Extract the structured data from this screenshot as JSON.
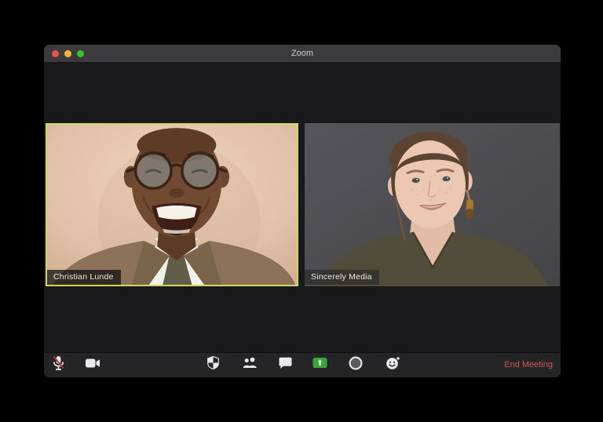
{
  "window": {
    "title": "Zoom"
  },
  "participants": [
    {
      "name": "Christian Lunde",
      "active_speaker": true,
      "video_on": true
    },
    {
      "name": "Sincerely Media",
      "active_speaker": false,
      "video_on": true
    }
  ],
  "toolbar": {
    "buttons": [
      {
        "id": "mute",
        "icon": "microphone-muted-icon",
        "state": "muted"
      },
      {
        "id": "video",
        "icon": "video-camera-icon",
        "state": "on"
      },
      {
        "id": "security",
        "icon": "shield-icon"
      },
      {
        "id": "participants",
        "icon": "participants-icon"
      },
      {
        "id": "chat",
        "icon": "chat-bubble-icon"
      },
      {
        "id": "share-screen",
        "icon": "share-screen-icon"
      },
      {
        "id": "record",
        "icon": "record-circle-icon"
      },
      {
        "id": "reactions",
        "icon": "reactions-smiley-icon"
      }
    ],
    "end_meeting_label": "End Meeting"
  },
  "colors": {
    "desktop_background": "#000000",
    "titlebar": "#3b3b3d",
    "content_background": "#19191b",
    "toolbar_background": "#252528",
    "active_speaker_border": "#ccd95e",
    "end_meeting_text": "#cf564c",
    "share_screen_green": "#3ea43c",
    "traffic_red": "#e6554d",
    "traffic_yellow": "#f0b72f",
    "traffic_green": "#31c431"
  }
}
